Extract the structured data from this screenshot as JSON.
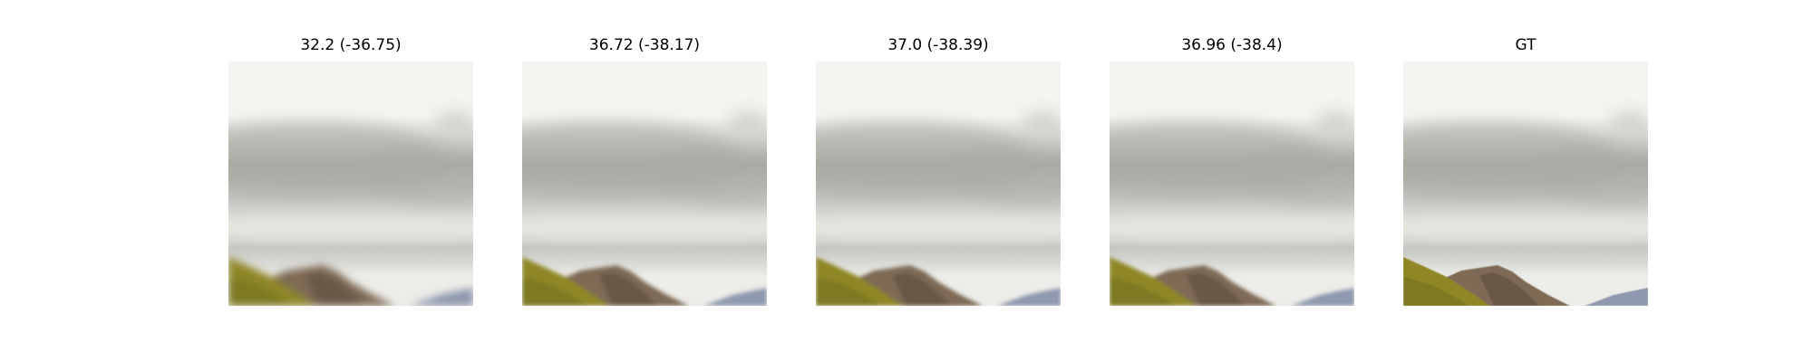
{
  "figure": {
    "panels": [
      {
        "title": "32.2 (-36.75)",
        "blur": 4.2
      },
      {
        "title": "36.72 (-38.17)",
        "blur": 2.4
      },
      {
        "title": "37.0 (-38.39)",
        "blur": 2.2
      },
      {
        "title": "36.96 (-38.4)",
        "blur": 2.2
      },
      {
        "title": "GT",
        "blur": 0.6
      }
    ],
    "colors": {
      "sky_top": "#f4f4f1",
      "cloud_dark": "#a9aaa4",
      "cloud_mid": "#c3c4bf",
      "haze_band": "#e6e6e1",
      "horizon_light": "#ecece8",
      "grass": "#8f8726",
      "grass_dark": "#6d6b1f",
      "rock": "#7e6a54",
      "rock_dark": "#5e4e40",
      "far_hills": "#8e98ae"
    }
  }
}
